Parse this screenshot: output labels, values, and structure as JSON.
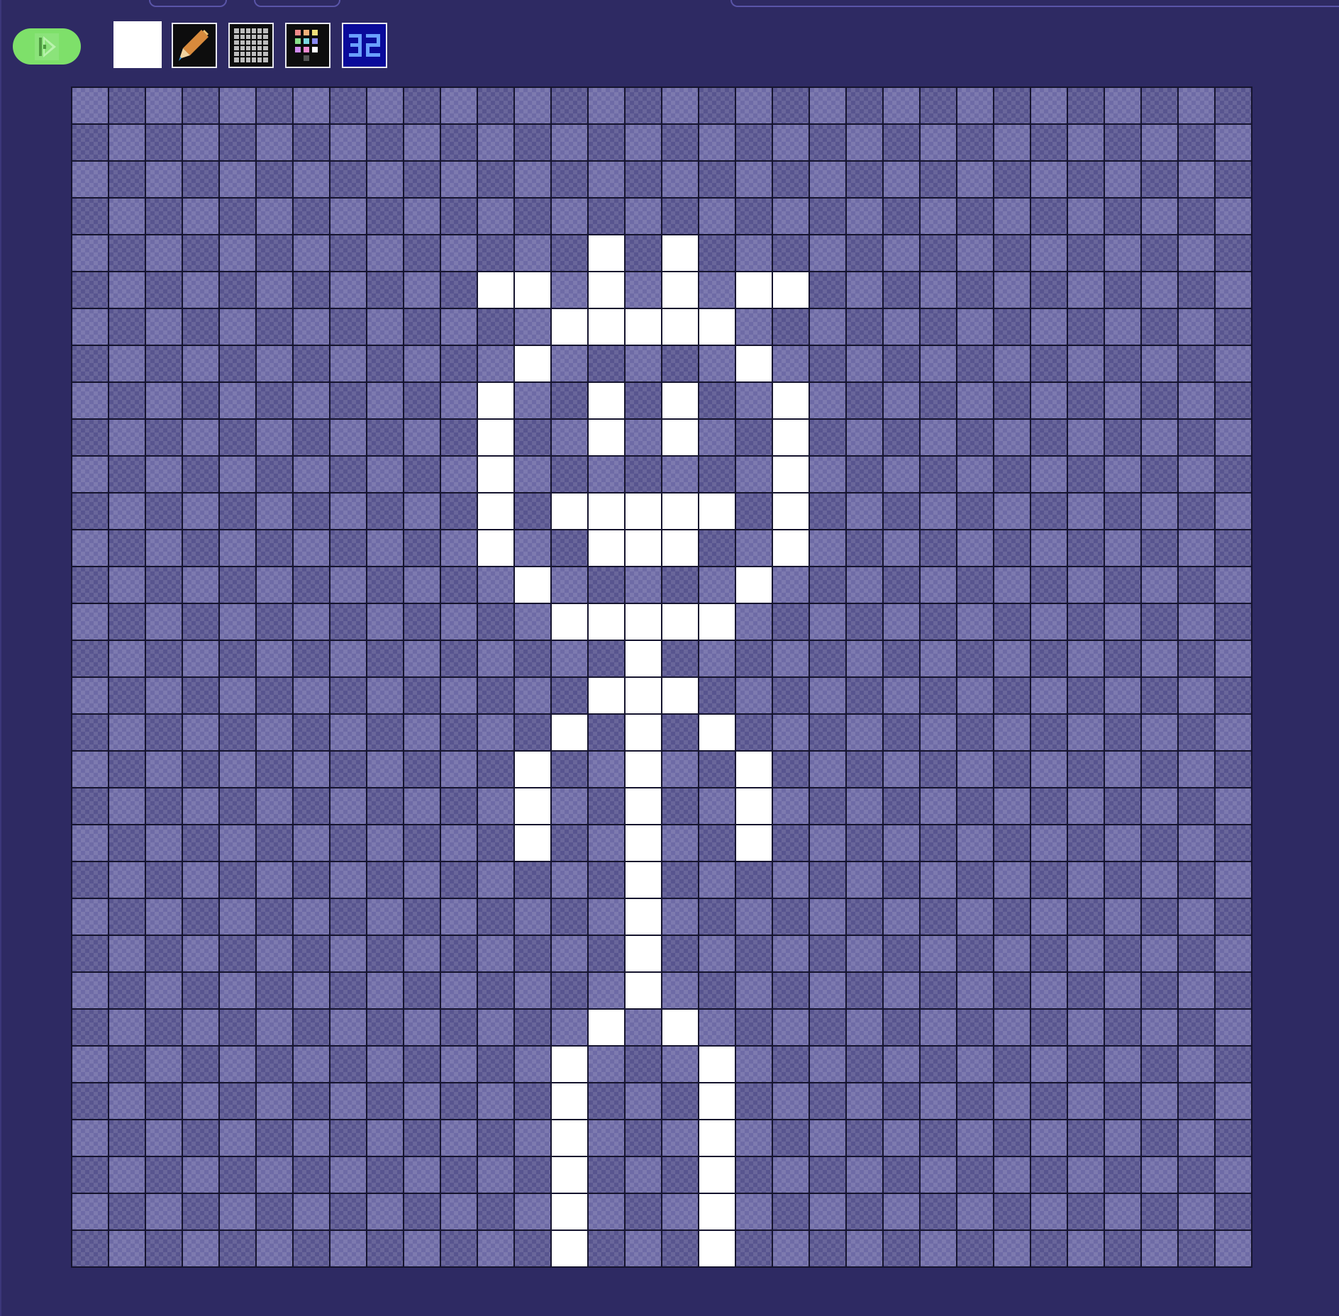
{
  "colors": {
    "background": "#2e2a63",
    "accent": "#7ee06a",
    "pixel_on": "#ffffff",
    "cell_light": "#6e6ba6",
    "cell_dark": "#58558f",
    "grid_line": "#15142e",
    "selected_color": "#ffffff"
  },
  "toolbar": {
    "run_icon": "play-icon",
    "tools": [
      {
        "name": "color-swatch",
        "icon": "color-swatch-icon"
      },
      {
        "name": "pencil-tool",
        "icon": "pencil-icon"
      },
      {
        "name": "grid-toggle",
        "icon": "grid-icon"
      },
      {
        "name": "palette",
        "icon": "palette-icon"
      },
      {
        "name": "size-32",
        "icon": "size-32-icon",
        "label": "32"
      }
    ]
  },
  "canvas": {
    "size": 32,
    "lit_pixels": [
      [
        4,
        14
      ],
      [
        4,
        16
      ],
      [
        5,
        11
      ],
      [
        5,
        12
      ],
      [
        5,
        14
      ],
      [
        5,
        16
      ],
      [
        5,
        18
      ],
      [
        5,
        19
      ],
      [
        6,
        13
      ],
      [
        6,
        14
      ],
      [
        6,
        15
      ],
      [
        6,
        16
      ],
      [
        6,
        17
      ],
      [
        7,
        12
      ],
      [
        7,
        18
      ],
      [
        8,
        11
      ],
      [
        8,
        14
      ],
      [
        8,
        16
      ],
      [
        8,
        19
      ],
      [
        9,
        11
      ],
      [
        9,
        14
      ],
      [
        9,
        16
      ],
      [
        9,
        19
      ],
      [
        10,
        11
      ],
      [
        10,
        19
      ],
      [
        11,
        11
      ],
      [
        11,
        13
      ],
      [
        11,
        14
      ],
      [
        11,
        15
      ],
      [
        11,
        16
      ],
      [
        11,
        17
      ],
      [
        11,
        19
      ],
      [
        12,
        11
      ],
      [
        12,
        14
      ],
      [
        12,
        15
      ],
      [
        12,
        16
      ],
      [
        12,
        19
      ],
      [
        13,
        12
      ],
      [
        13,
        18
      ],
      [
        14,
        13
      ],
      [
        14,
        14
      ],
      [
        14,
        15
      ],
      [
        14,
        16
      ],
      [
        14,
        17
      ],
      [
        15,
        15
      ],
      [
        16,
        14
      ],
      [
        16,
        15
      ],
      [
        16,
        16
      ],
      [
        17,
        13
      ],
      [
        17,
        15
      ],
      [
        17,
        17
      ],
      [
        18,
        12
      ],
      [
        18,
        15
      ],
      [
        18,
        18
      ],
      [
        19,
        12
      ],
      [
        19,
        15
      ],
      [
        19,
        18
      ],
      [
        20,
        12
      ],
      [
        20,
        15
      ],
      [
        20,
        18
      ],
      [
        21,
        15
      ],
      [
        22,
        15
      ],
      [
        23,
        15
      ],
      [
        24,
        15
      ],
      [
        25,
        14
      ],
      [
        25,
        16
      ],
      [
        26,
        13
      ],
      [
        26,
        17
      ],
      [
        27,
        13
      ],
      [
        27,
        17
      ],
      [
        28,
        13
      ],
      [
        28,
        17
      ],
      [
        29,
        13
      ],
      [
        29,
        17
      ],
      [
        30,
        13
      ],
      [
        30,
        17
      ],
      [
        31,
        13
      ],
      [
        31,
        17
      ]
    ]
  }
}
